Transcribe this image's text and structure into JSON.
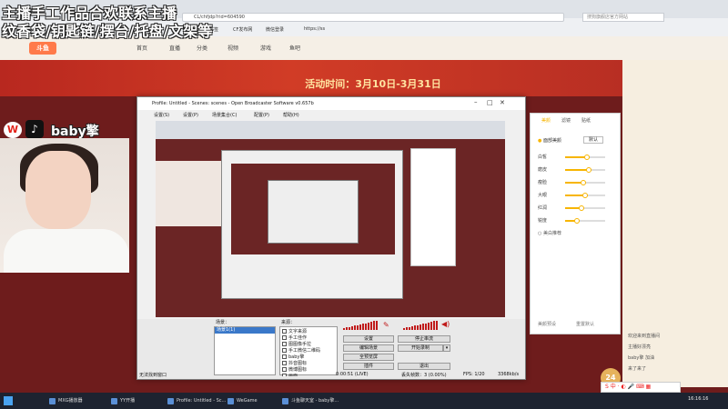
{
  "overlay": {
    "line1": "主播手工作品合欢联系主播",
    "line2": "纹香袋/钥匙链/摆台/托盘/文架等"
  },
  "browser": {
    "url": "CL/chfjdp?rid=604590",
    "search_hint": "搜狗旗舰店官方网站",
    "bookmarks": [
      "书签",
      "CF发布网",
      "微信登录",
      "https://ss"
    ]
  },
  "site": {
    "logo": "斗鱼",
    "nav": [
      "首页",
      "直播",
      "分类",
      "视频",
      "游戏",
      "鱼吧"
    ],
    "banner": "活动时间：3月10日-3月31日"
  },
  "streamer": {
    "name": "baby擎"
  },
  "obs": {
    "title": "Profile: Untitled - Scenes: scenes - Open Broadcaster Software v0.657b",
    "menu": [
      "设置(S)",
      "设置(P)",
      "场景集合(C)",
      "配置(P)",
      "帮助(H)"
    ],
    "scenes_label": "场景：",
    "scenes": [
      "场景1(1)"
    ],
    "sources_label": "来源：",
    "sources": [
      "文字来源",
      "手工佳作",
      "图图像手拉",
      "手工微信二维码",
      "baby擎",
      "抖音图标",
      "微博图标",
      "画面"
    ],
    "buttons": {
      "settings": "设置",
      "stop_stream": "停止串流",
      "edit_scene": "编辑场景",
      "start_record": "开始录制",
      "fullscreen": "全预览屏",
      "plugins": "插件",
      "exit": "退出"
    },
    "status": {
      "scene_status": "无法找到窗口",
      "time": "0:00:51 (LIVE)",
      "dropped": "丢失帧数：3 (0.00%)",
      "fps": "FPS: 1/20",
      "bitrate": "3368kb/s"
    }
  },
  "beauty": {
    "tabs": [
      "美颜",
      "滤镜",
      "贴纸"
    ],
    "toggle": "面部美颜",
    "preset": "默认",
    "sliders": [
      {
        "label": "白皙",
        "value": 0.55
      },
      {
        "label": "磨皮",
        "value": 0.6
      },
      {
        "label": "瘦脸",
        "value": 0.45
      },
      {
        "label": "大眼",
        "value": 0.5
      },
      {
        "label": "红润",
        "value": 0.4
      },
      {
        "label": "锐度",
        "value": 0.3
      }
    ],
    "extra_toggle": "美白推荐",
    "footer_left": "美颜预设",
    "footer_right": "重置默认"
  },
  "chat": {
    "lines": [
      "欢迎来到直播间",
      "主播好漂亮",
      "baby擎 加油",
      "来了来了"
    ]
  },
  "taskbar": {
    "items": [
      "MXG播放器",
      "YY开播",
      "Profile: Untitled - Sc...",
      "WeGame",
      "斗鱼聊天室 - baby擎..."
    ],
    "clock": "16:16:16"
  },
  "badge": "24"
}
